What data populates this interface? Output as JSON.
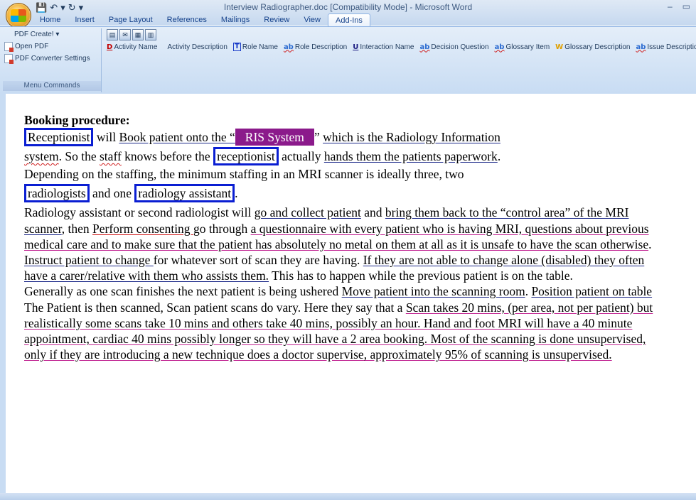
{
  "window": {
    "title": "Interview Radiographer.doc [Compatibility Mode] - Microsoft Word",
    "controls": [
      "–",
      "▭"
    ]
  },
  "qat": {
    "save": "💾",
    "undo": "↶ ▾",
    "redo": "↻",
    "custom": "▾"
  },
  "tabs": [
    "Home",
    "Insert",
    "Page Layout",
    "References",
    "Mailings",
    "Review",
    "View",
    "Add-Ins"
  ],
  "active_tab": "Add-Ins",
  "ribbon": {
    "menu_commands": {
      "items": [
        "PDF Create! ▾",
        "Open PDF",
        "PDF Converter Settings"
      ],
      "label": "Menu Commands"
    },
    "commands": [
      {
        "glyph": "D",
        "label": "Activity Name"
      },
      {
        "glyph": "",
        "label": "Activity Description"
      },
      {
        "glyph": "T",
        "label": "Role Name"
      },
      {
        "glyph": "ab",
        "label": "Role Description"
      },
      {
        "glyph": "U",
        "label": "Interaction Name"
      },
      {
        "glyph": "ab",
        "label": "Decision Question"
      },
      {
        "glyph": "ab",
        "label": "Glossary Item"
      },
      {
        "glyph": "W",
        "label": "Glossary Description"
      },
      {
        "glyph": "ab",
        "label": "Issue Descriptio"
      }
    ]
  },
  "document": {
    "heading": "Booking procedure:",
    "p1": {
      "role1": "Receptionist",
      "t1": " will ",
      "act1": "Book patient onto the “",
      "sys": "RIS System",
      "t2": "” ",
      "u1": "which is the Radiology Information",
      "u1b": "system",
      "t3": ". So the ",
      "staff": "staff",
      "t4": " knows before the ",
      "role2": "receptionist",
      "t5": " actually ",
      "act2": "hands them the patients paperwork",
      "t6": "."
    },
    "p2": {
      "t1": "Depending on the staffing, the minimum staffing in an MRI scanner is ideally three, two",
      "role3": "radiologists",
      "t2": " and one ",
      "role4": "radiology assistant",
      "t3": "."
    },
    "p3": {
      "t1": "Radiology assistant or second radiologist will ",
      "a1": "go and collect patient",
      "t2": " and ",
      "a2": "bring them back to the “control area” of the MRI scanner",
      "t3": ", then ",
      "a3": "Perform consenting ",
      "t4": "go through ",
      "a4": "a questionnaire with every patient who is having MRI, questions about previous medical care and to make sure that the patient has absolutely no metal on them at all as it is unsafe to have the scan otherwise",
      "t5": ". ",
      "a5": "Instruct patient to change ",
      "t6": "for whatever sort of scan they are having. ",
      "a6": "If they are not able to change alone (disabled) they often have a carer/relative with them who assists them.",
      "t7": " This has to happen while the previous patient is on the table."
    },
    "p4": {
      "t1": "Generally as one scan finishes the next patient is being ushered ",
      "a1": "Move patient into the scanning room",
      "t2": ". ",
      "a2": "Position patient on table"
    },
    "p5": {
      "t1": "The Patient is then scanned, Scan patient scans do vary. Here they say that a ",
      "a1": "Scan takes 20 mins, (per area, not per patient) but realistically some scans take 10 mins and others take 40 mins, possibly an hour.  Hand and foot MRI will have a 40 minute appointment, cardiac 40 mins possibly longer so they will have a 2 area booking. Most of the scanning is done unsupervised, only if they are introducing a new technique does a doctor supervise, approximately 95% of scanning is unsupervised."
    }
  }
}
